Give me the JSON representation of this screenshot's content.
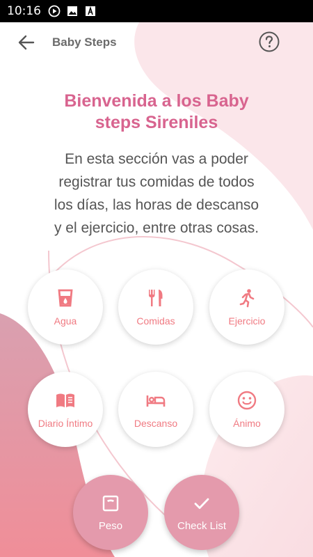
{
  "status_bar": {
    "time": "10:16"
  },
  "toolbar": {
    "title": "Baby Steps"
  },
  "welcome": {
    "line1": "Bienvenida a los Baby",
    "line2": "steps Sireniles"
  },
  "description": {
    "line1": "En esta sección vas a poder",
    "line2": "registrar tus comidas de todos",
    "line3": "los días, las horas de descanso",
    "line4": "y el ejercicio, entre otras cosas."
  },
  "options": [
    {
      "label": "Agua",
      "icon": "water-glass-icon"
    },
    {
      "label": "Comidas",
      "icon": "utensils-icon"
    },
    {
      "label": "Ejercicio",
      "icon": "running-icon"
    },
    {
      "label": "Diario Íntimo",
      "icon": "book-icon"
    },
    {
      "label": "Descanso",
      "icon": "bed-icon"
    },
    {
      "label": "Ánimo",
      "icon": "smiley-icon"
    }
  ],
  "actions": [
    {
      "label": "Peso",
      "icon": "scale-icon"
    },
    {
      "label": "Check List",
      "icon": "check-icon"
    }
  ],
  "colors": {
    "accent": "#f07a82",
    "title": "#d8648f",
    "big_button": "#e49aac"
  }
}
